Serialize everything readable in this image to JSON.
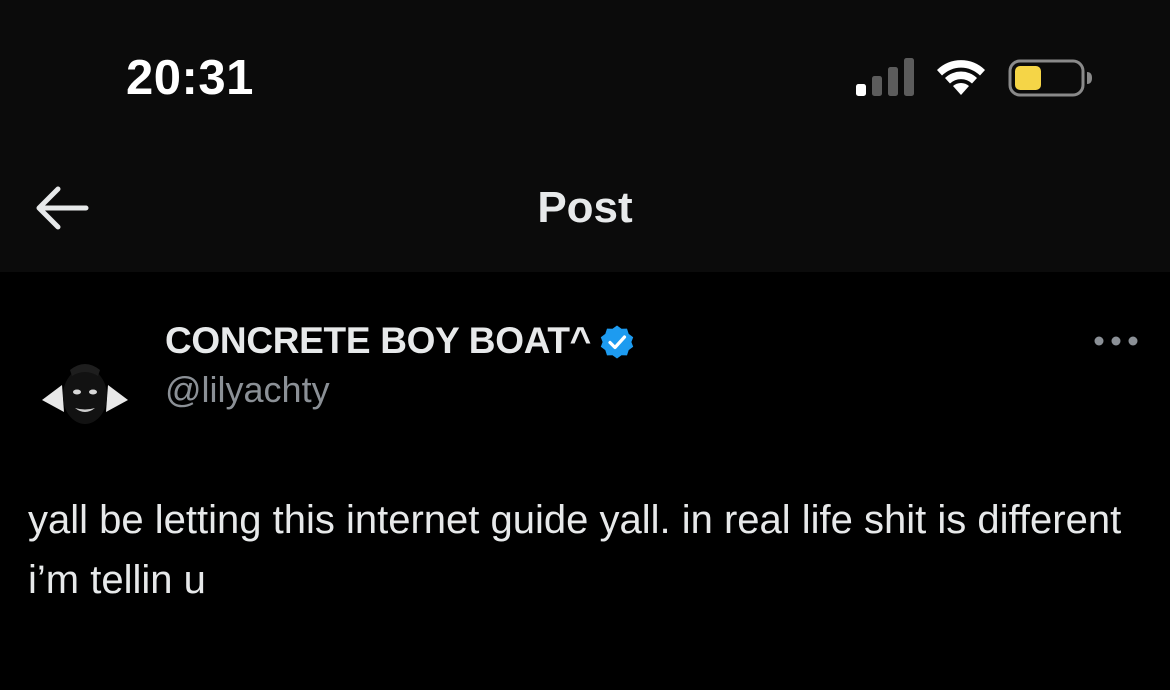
{
  "status_bar": {
    "time": "20:31",
    "signal_icon": "cellular-signal-icon",
    "wifi_icon": "wifi-icon",
    "battery_icon": "battery-low-power-icon",
    "battery_color": "#f5d547"
  },
  "header": {
    "back_icon": "arrow-left-icon",
    "title": "Post"
  },
  "post": {
    "author_name": "CONCRETE BOY BOAT^",
    "verified_icon": "verified-badge-icon",
    "verified_color": "#1d9bf0",
    "handle": "@lilyachty",
    "more_icon": "more-horizontal-icon",
    "text": "yall be letting this internet guide yall. in real life shit is different i’m tellin u"
  },
  "colors": {
    "background": "#000000",
    "header_background": "#0b0b0b",
    "text_primary": "#e7e9ea",
    "text_secondary": "#8b9096"
  }
}
